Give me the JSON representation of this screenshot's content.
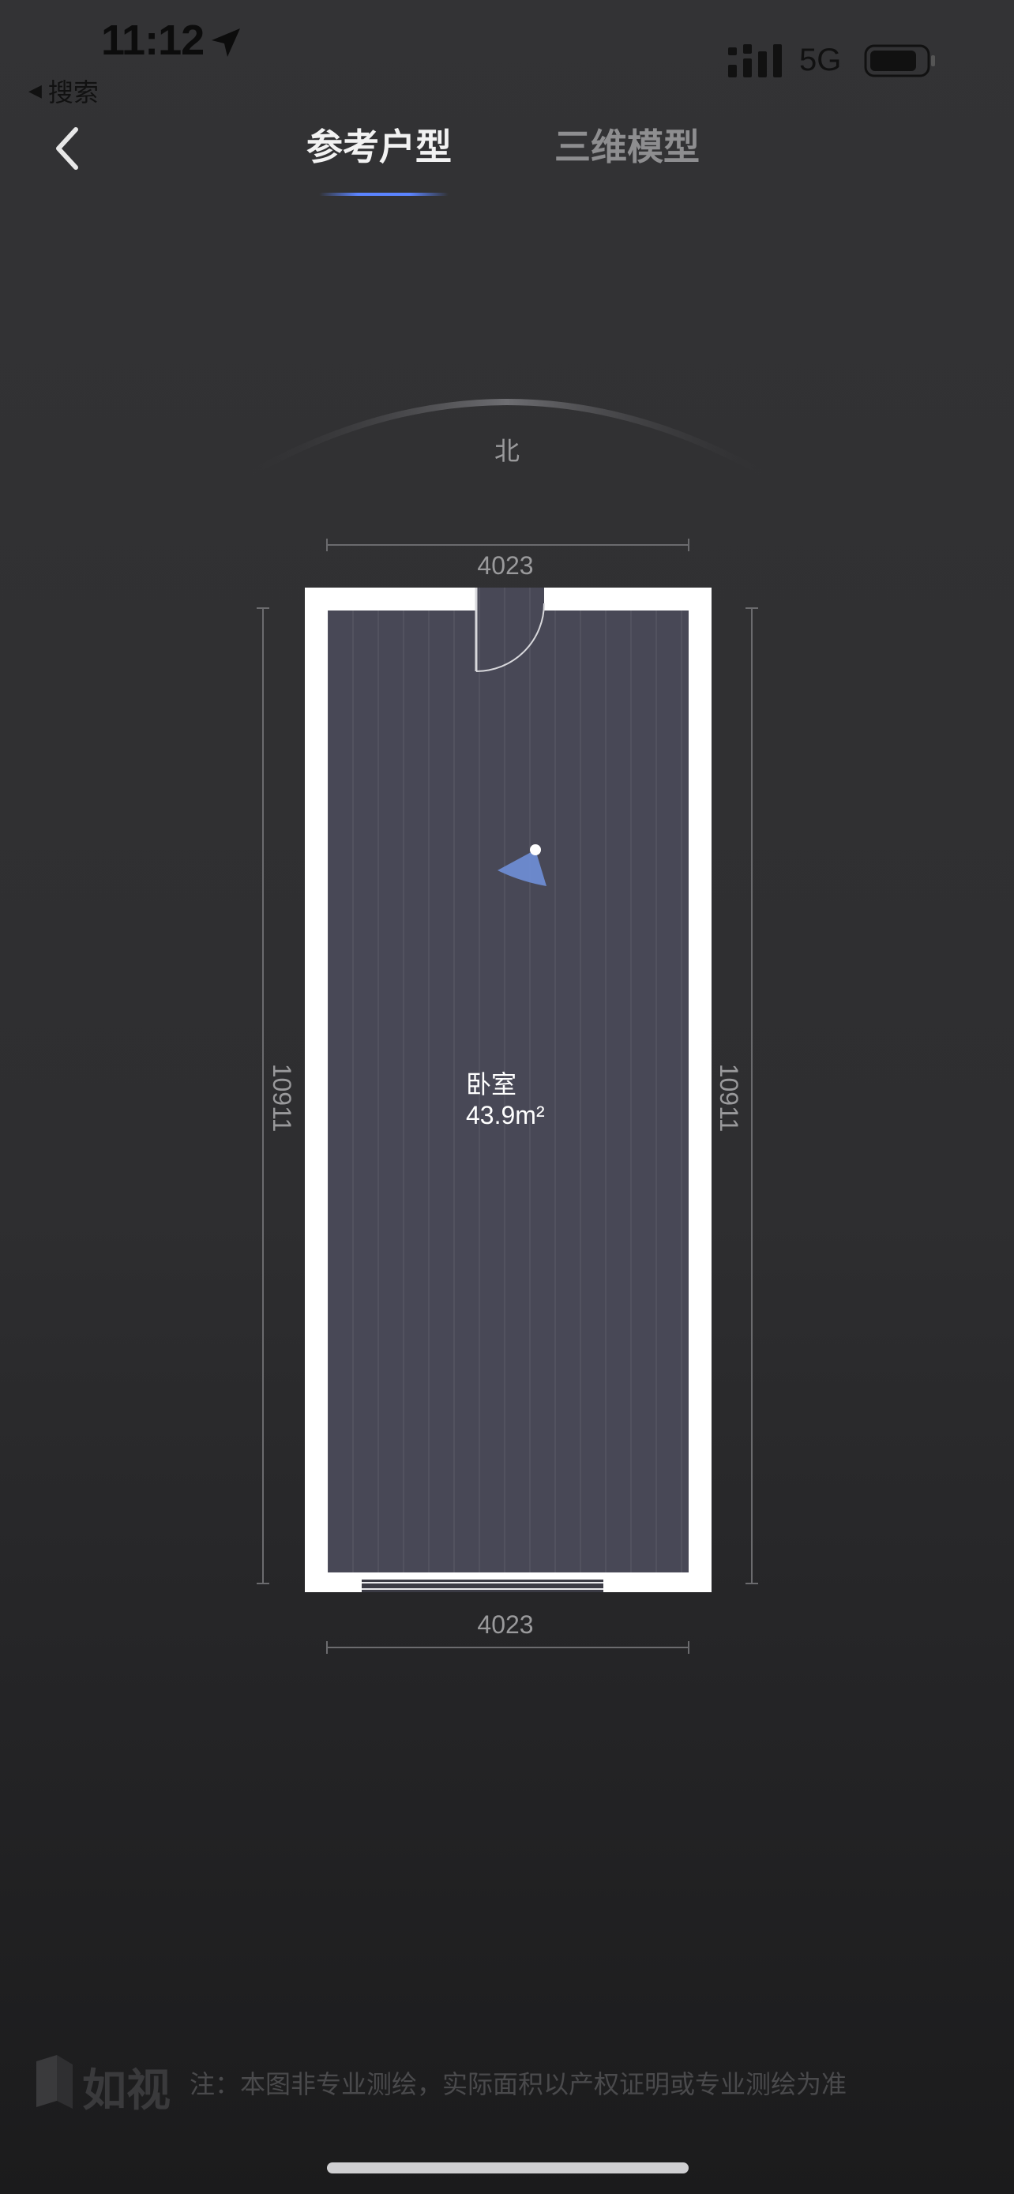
{
  "status_bar": {
    "time": "11:12",
    "back_to_app": "搜索",
    "network": "5G",
    "icons": [
      "location-arrow-icon",
      "signal-icon",
      "battery-icon"
    ]
  },
  "nav": {
    "back_icon": "chevron-left-icon",
    "tabs": [
      {
        "label": "参考户型",
        "active": true
      },
      {
        "label": "三维模型",
        "active": false
      }
    ],
    "accent": "#5b84ff"
  },
  "compass": {
    "north_label": "北"
  },
  "floorplan": {
    "dimensions": {
      "top": "4023",
      "bottom": "4023",
      "left": "10911",
      "right": "10911"
    },
    "room": {
      "name": "卧室",
      "area": "43.9m²"
    },
    "floor_color": "#484856",
    "wall_color": "#ffffff"
  },
  "footer": {
    "brand": "如视",
    "disclaimer": "注：本图非专业测绘，实际面积以产权证明或专业测绘为准"
  }
}
